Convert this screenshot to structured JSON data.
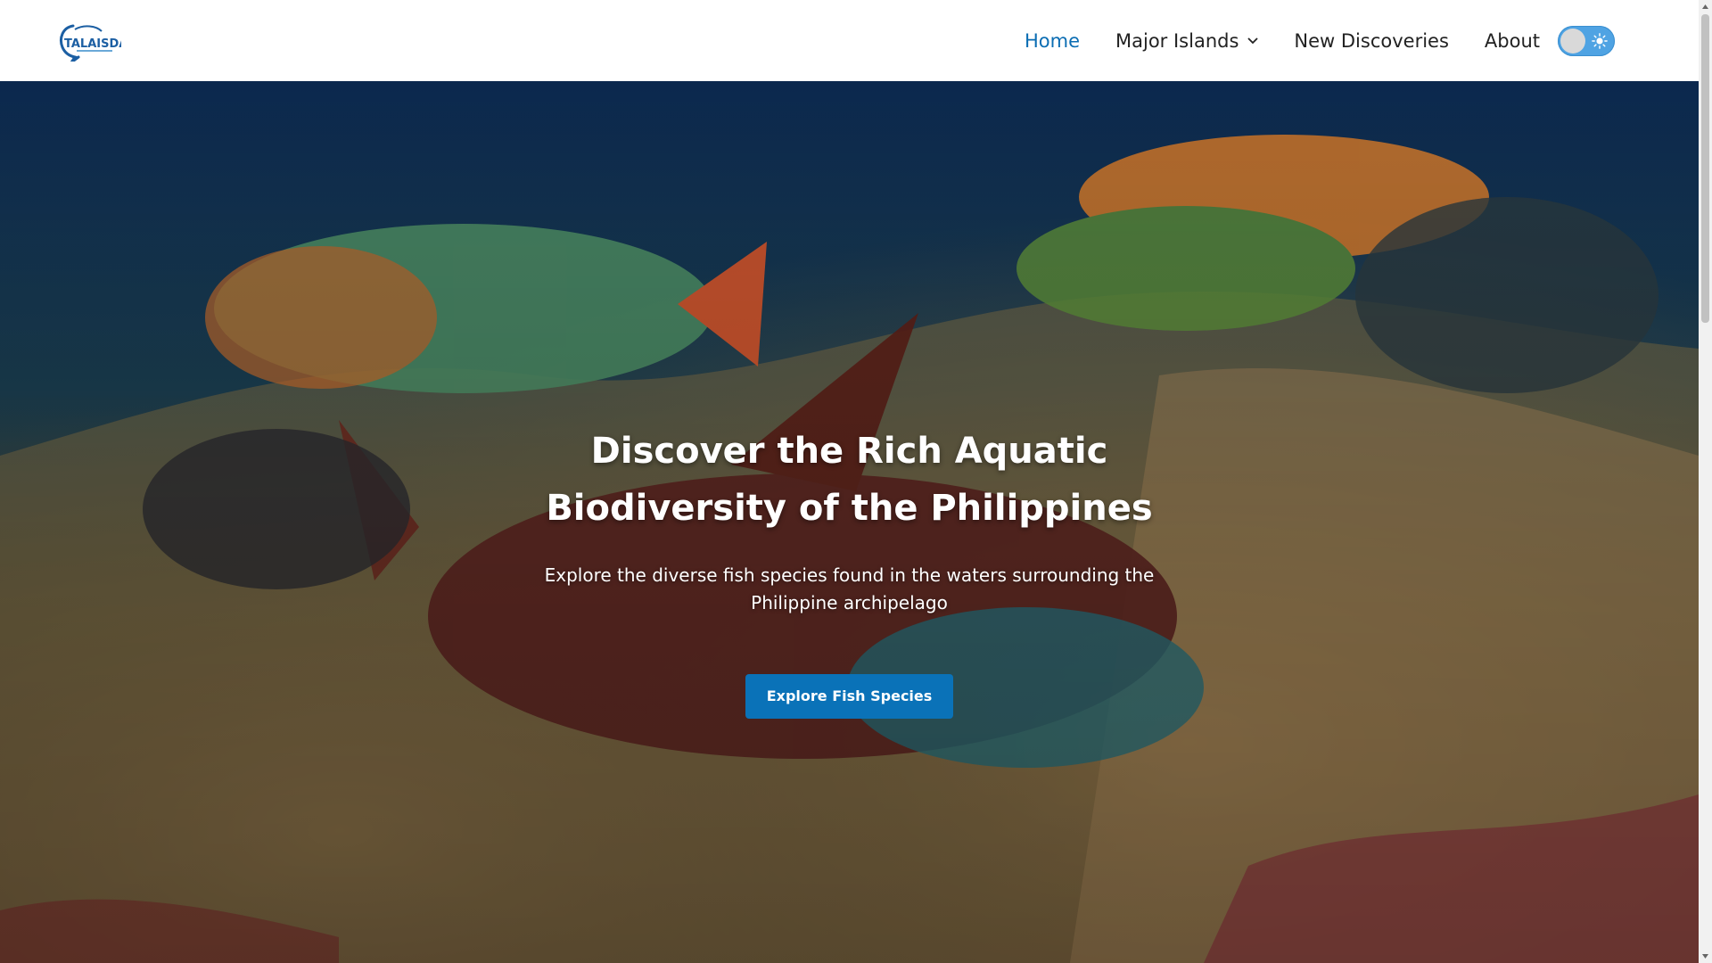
{
  "brand": {
    "logo_text": "TALAISDA",
    "logo_color": "#1c5fa3"
  },
  "nav": {
    "items": [
      {
        "label": "Home",
        "active": true
      },
      {
        "label": "Major Islands",
        "has_dropdown": true
      },
      {
        "label": "New Discoveries"
      },
      {
        "label": "About"
      }
    ],
    "theme_toggle": {
      "icons": [
        "sun-icon"
      ]
    }
  },
  "hero": {
    "title": "Discover the Rich Aquatic Biodiversity of the Philippines",
    "subtitle": "Explore the diverse fish species found in the waters surrounding the Philippine archipelago",
    "cta_label": "Explore Fish Species"
  },
  "colors": {
    "accent": "#0a72b8",
    "active_link": "#0b6db3",
    "toggle": "#4fa3e3"
  }
}
